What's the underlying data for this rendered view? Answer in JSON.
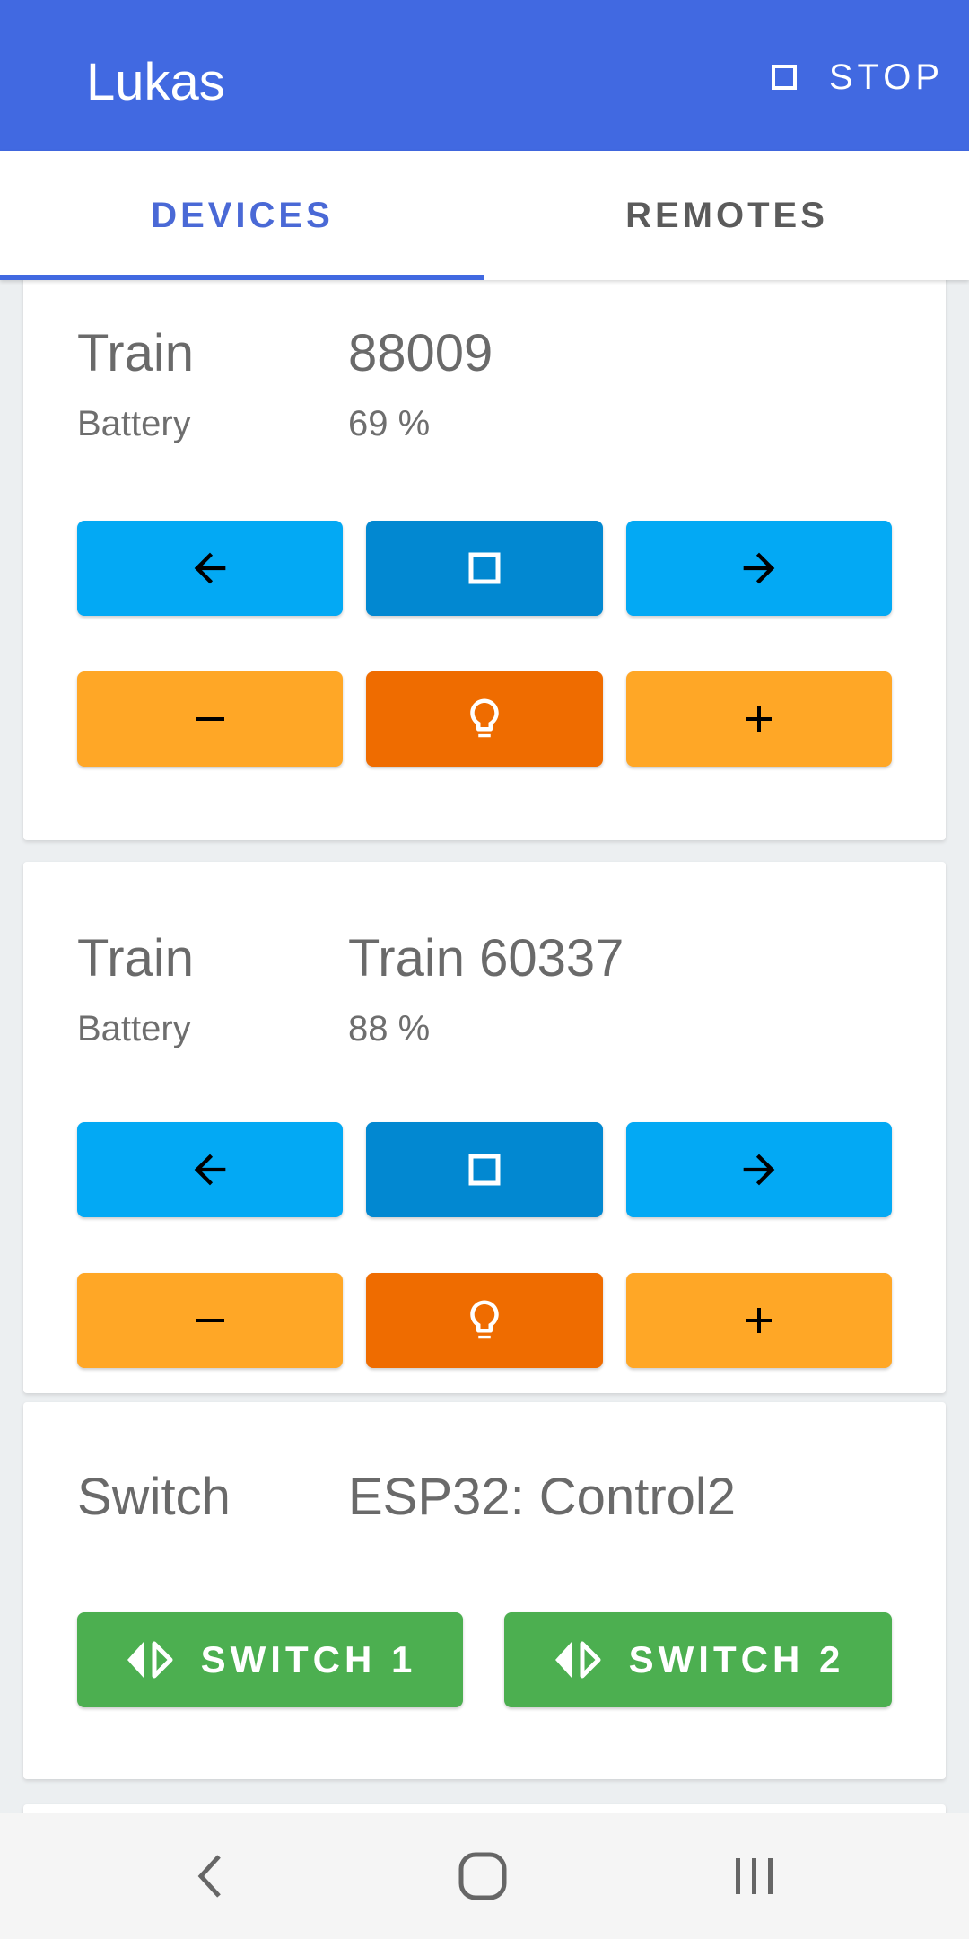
{
  "app": {
    "title": "Lukas",
    "stop_label": "STOP"
  },
  "tabs": [
    {
      "label": "DEVICES",
      "active": true
    },
    {
      "label": "REMOTES",
      "active": false
    }
  ],
  "devices": [
    {
      "type": "Train",
      "name": "88009",
      "battery_label": "Battery",
      "battery_value": "69 %"
    },
    {
      "type": "Train",
      "name": "Train 60337",
      "battery_label": "Battery",
      "battery_value": "88 %"
    },
    {
      "type": "Switch",
      "name": "ESP32: Control2",
      "buttons": [
        "SWITCH 1",
        "SWITCH 2"
      ]
    }
  ],
  "icons": {
    "backward": "arrow-left-icon",
    "stop": "stop-square-icon",
    "forward": "arrow-right-icon",
    "decrease": "minus-icon",
    "light": "lightbulb-icon",
    "increase": "plus-icon",
    "switch": "switch-arrows-icon"
  },
  "colors": {
    "primary": "#4169e1",
    "direction_button": "#03a9f4",
    "stop_button": "#0288d1",
    "speed_button": "#ffa726",
    "light_button": "#ef6c00",
    "switch_button": "#4caf50"
  }
}
